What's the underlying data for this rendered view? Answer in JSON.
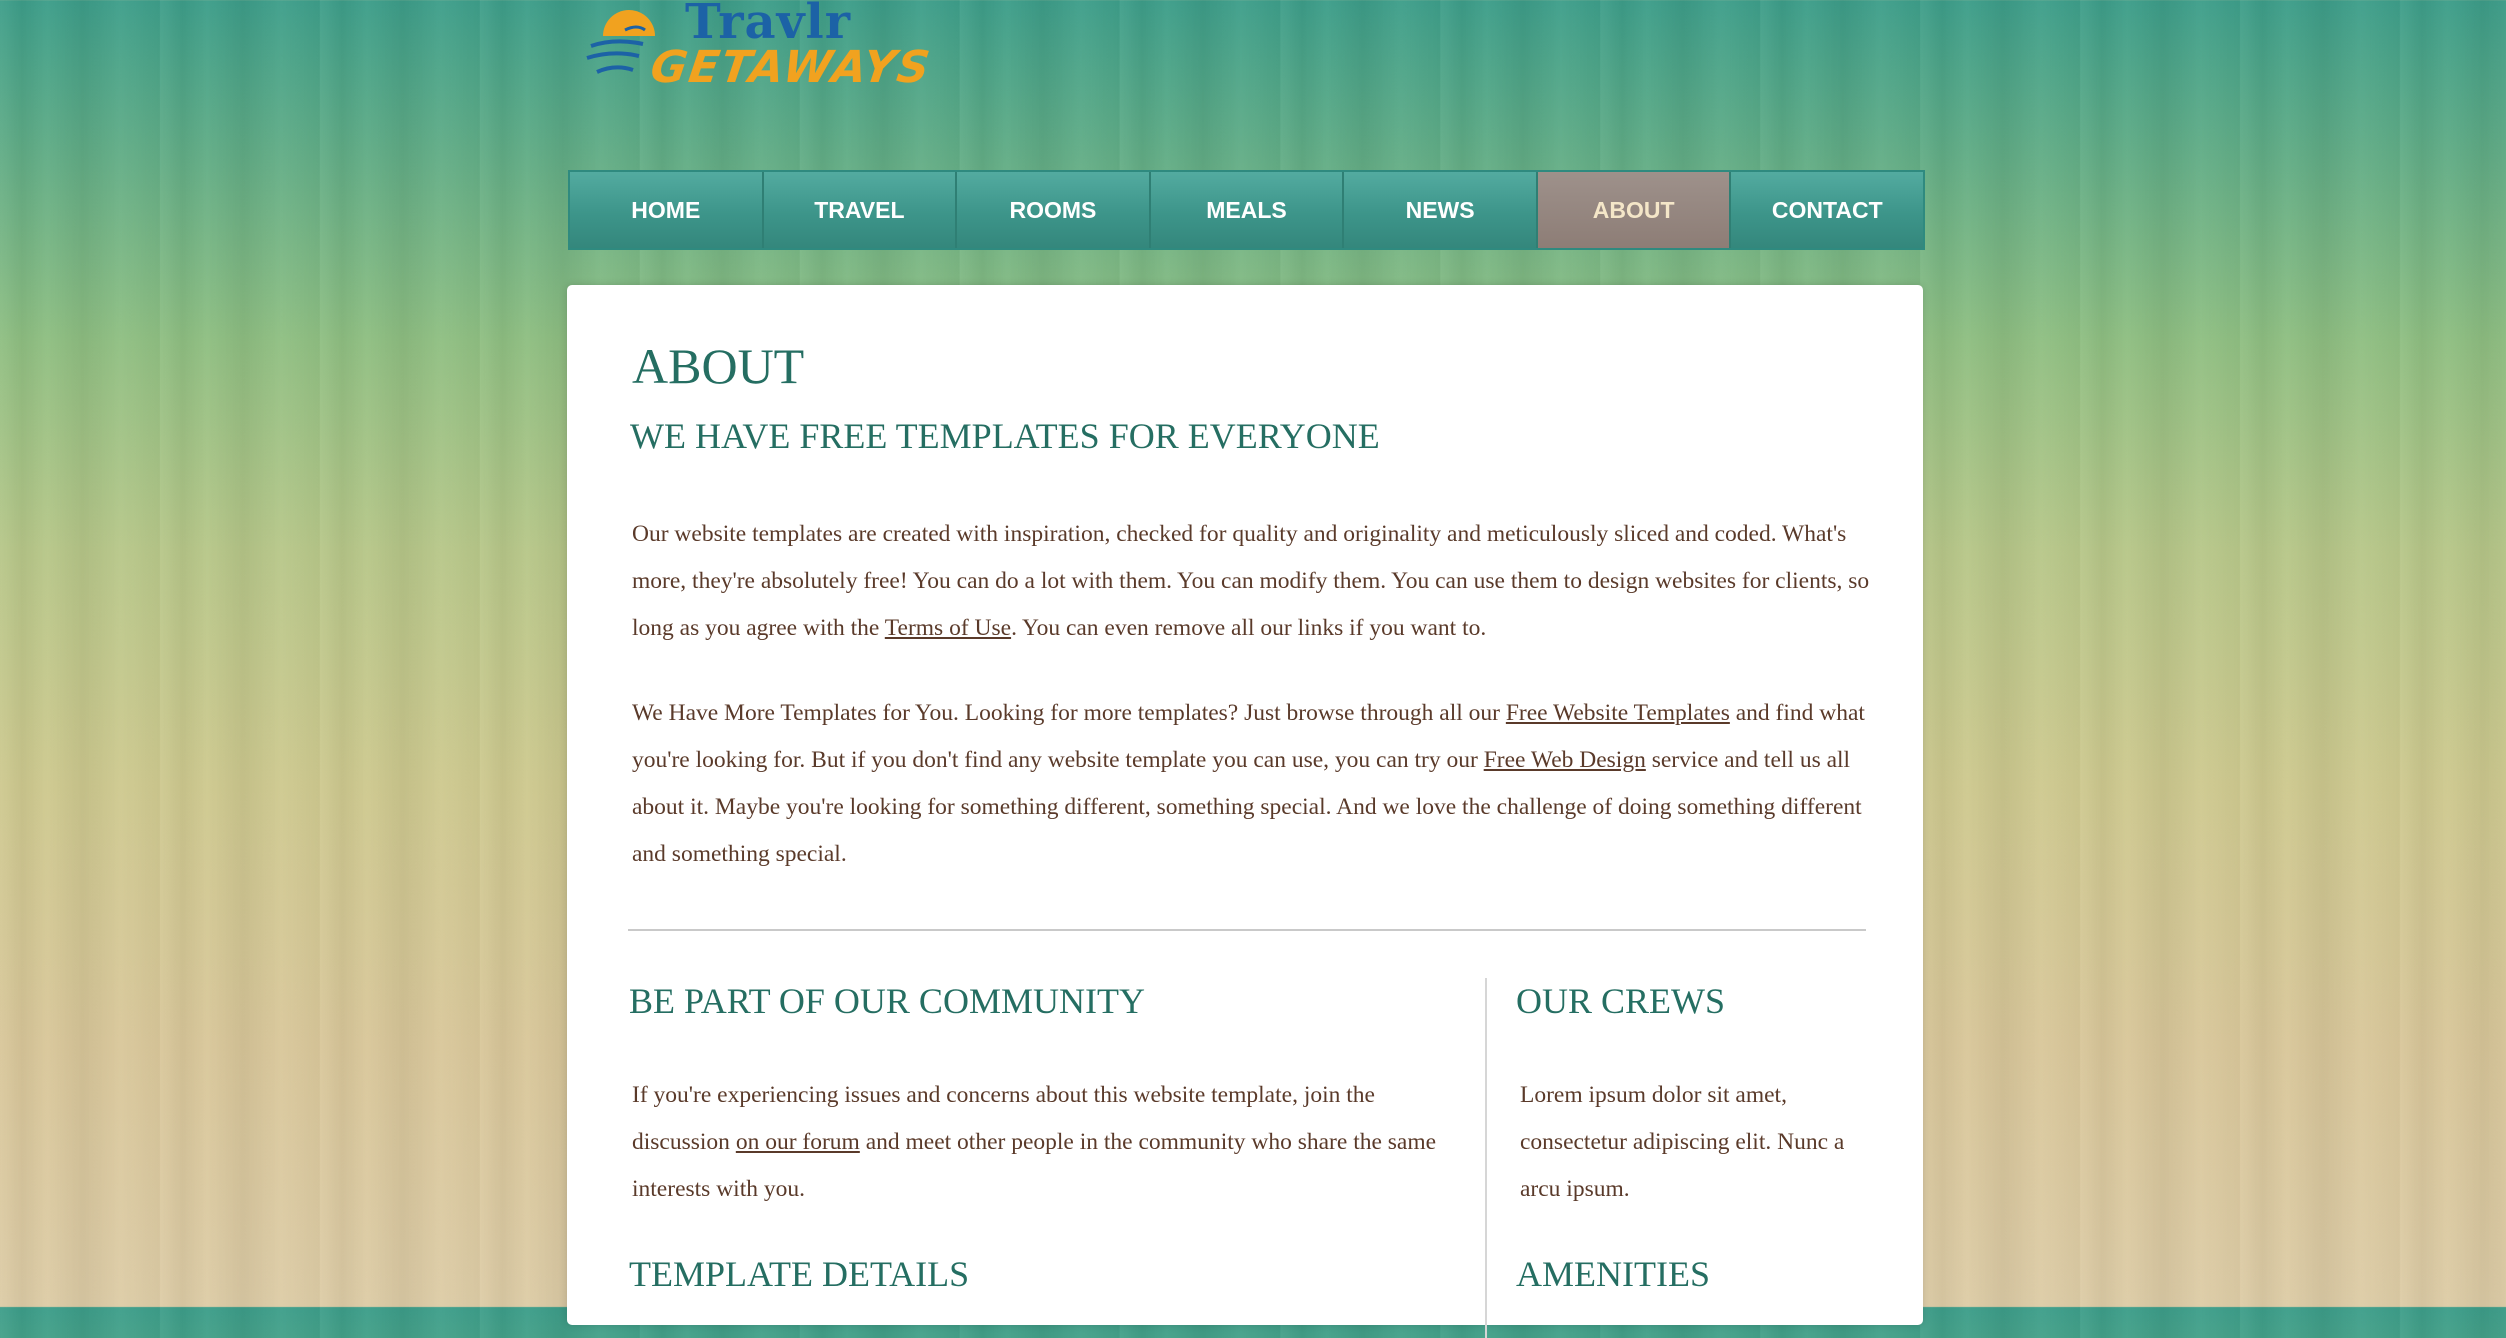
{
  "logo": {
    "line1": "Travlr",
    "line2": "GETAWAYS",
    "colors": {
      "blue": "#1c62a6",
      "orange": "#f1a21f"
    }
  },
  "nav": {
    "items": [
      {
        "label": "HOME"
      },
      {
        "label": "TRAVEL"
      },
      {
        "label": "ROOMS"
      },
      {
        "label": "MEALS"
      },
      {
        "label": "NEWS"
      },
      {
        "label": "ABOUT",
        "active": true
      },
      {
        "label": "CONTACT"
      }
    ],
    "colors": {
      "base": "#3e968b",
      "active": "#8d7d76",
      "active_text": "#f4e6c8"
    }
  },
  "about": {
    "title": "ABOUT",
    "subtitle": "WE HAVE FREE TEMPLATES FOR EVERYONE",
    "p1": {
      "text_before": "Our website templates are created with inspiration, checked for quality and originality and meticulously sliced and coded. What's more, they're absolutely free! You can do a lot with them. You can modify them. You can use them to design websites for clients, so long as you agree with the ",
      "link": "Terms of Use",
      "text_after": ". You can even remove all our links if you want to."
    },
    "p2": {
      "text_1": "We Have More Templates for You. Looking for more templates? Just browse through all our ",
      "link_1": "Free Website Templates",
      "text_2": " and find what you're looking for. But if you don't find any website template you can use, you can try our ",
      "link_2": "Free Web Design",
      "text_3": " service and tell us all about it. Maybe you're looking for something different, something special. And we love the challenge of doing something different and something special."
    }
  },
  "community": {
    "heading": "BE PART OF OUR COMMUNITY",
    "text_before": "If you're experiencing issues and concerns about this website template, join the discussion ",
    "link": "on our forum",
    "text_after": " and meet other people in the community who share the same interests with you."
  },
  "crews": {
    "heading": "OUR CREWS",
    "text": "Lorem ipsum dolor sit amet, consectetur adipiscing elit. Nunc a arcu ipsum."
  },
  "template_details": {
    "heading": "TEMPLATE DETAILS"
  },
  "amenities": {
    "heading": "AMENITIES"
  },
  "theme": {
    "heading_color": "#256e62",
    "text_color": "#5a3a2a"
  }
}
